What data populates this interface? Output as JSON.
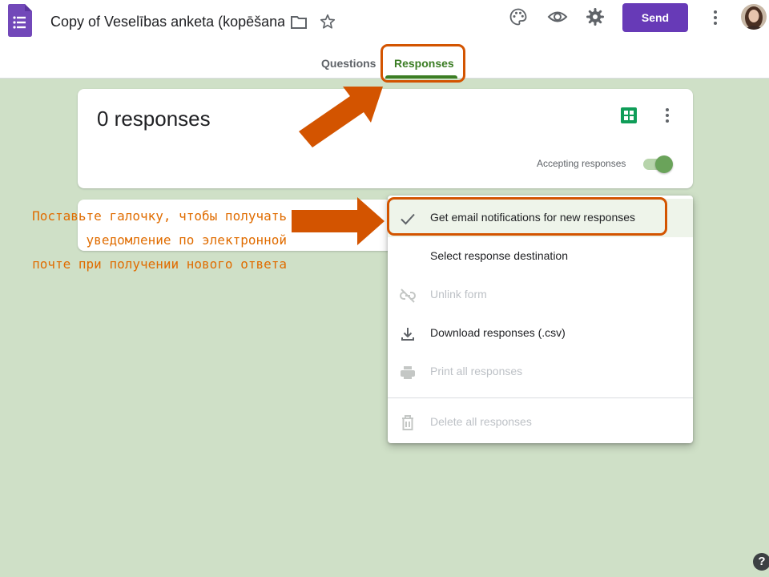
{
  "header": {
    "document_title": "Copy of Veselības anketa (kopēšana",
    "send_label": "Send",
    "icons": [
      "forms-logo-icon",
      "folder-icon",
      "star-icon",
      "palette-icon",
      "eye-icon",
      "gear-icon",
      "more-vert-icon",
      "avatar"
    ]
  },
  "tabs": [
    {
      "label": "Questions",
      "active": false
    },
    {
      "label": "Responses",
      "active": true
    }
  ],
  "summary_card": {
    "title": "0 responses",
    "accepting_label": "Accepting responses",
    "accepting_enabled": true
  },
  "menu": {
    "items": [
      {
        "label": "Get email notifications for new responses",
        "icon": "check-icon",
        "enabled": true,
        "checked": true
      },
      {
        "label": "Select response destination",
        "icon": "",
        "enabled": true
      },
      {
        "label": "Unlink form",
        "icon": "unlink-icon",
        "enabled": false
      },
      {
        "label": "Download responses (.csv)",
        "icon": "download-icon",
        "enabled": true
      },
      {
        "label": "Print all responses",
        "icon": "print-icon",
        "enabled": false
      },
      {
        "label": "Delete all responses",
        "icon": "trash-icon",
        "enabled": false
      }
    ]
  },
  "annotation": {
    "lines": [
      "Поставьте галочку, чтобы получать",
      "уведомление по электронной",
      "почте при получении нового ответа"
    ]
  },
  "help": {
    "glyph": "?"
  },
  "colors": {
    "accent_purple": "#673ab7",
    "tab_active_green": "#3b7d24",
    "page_background": "#cfe0c7",
    "annotation_orange": "#d35400"
  }
}
